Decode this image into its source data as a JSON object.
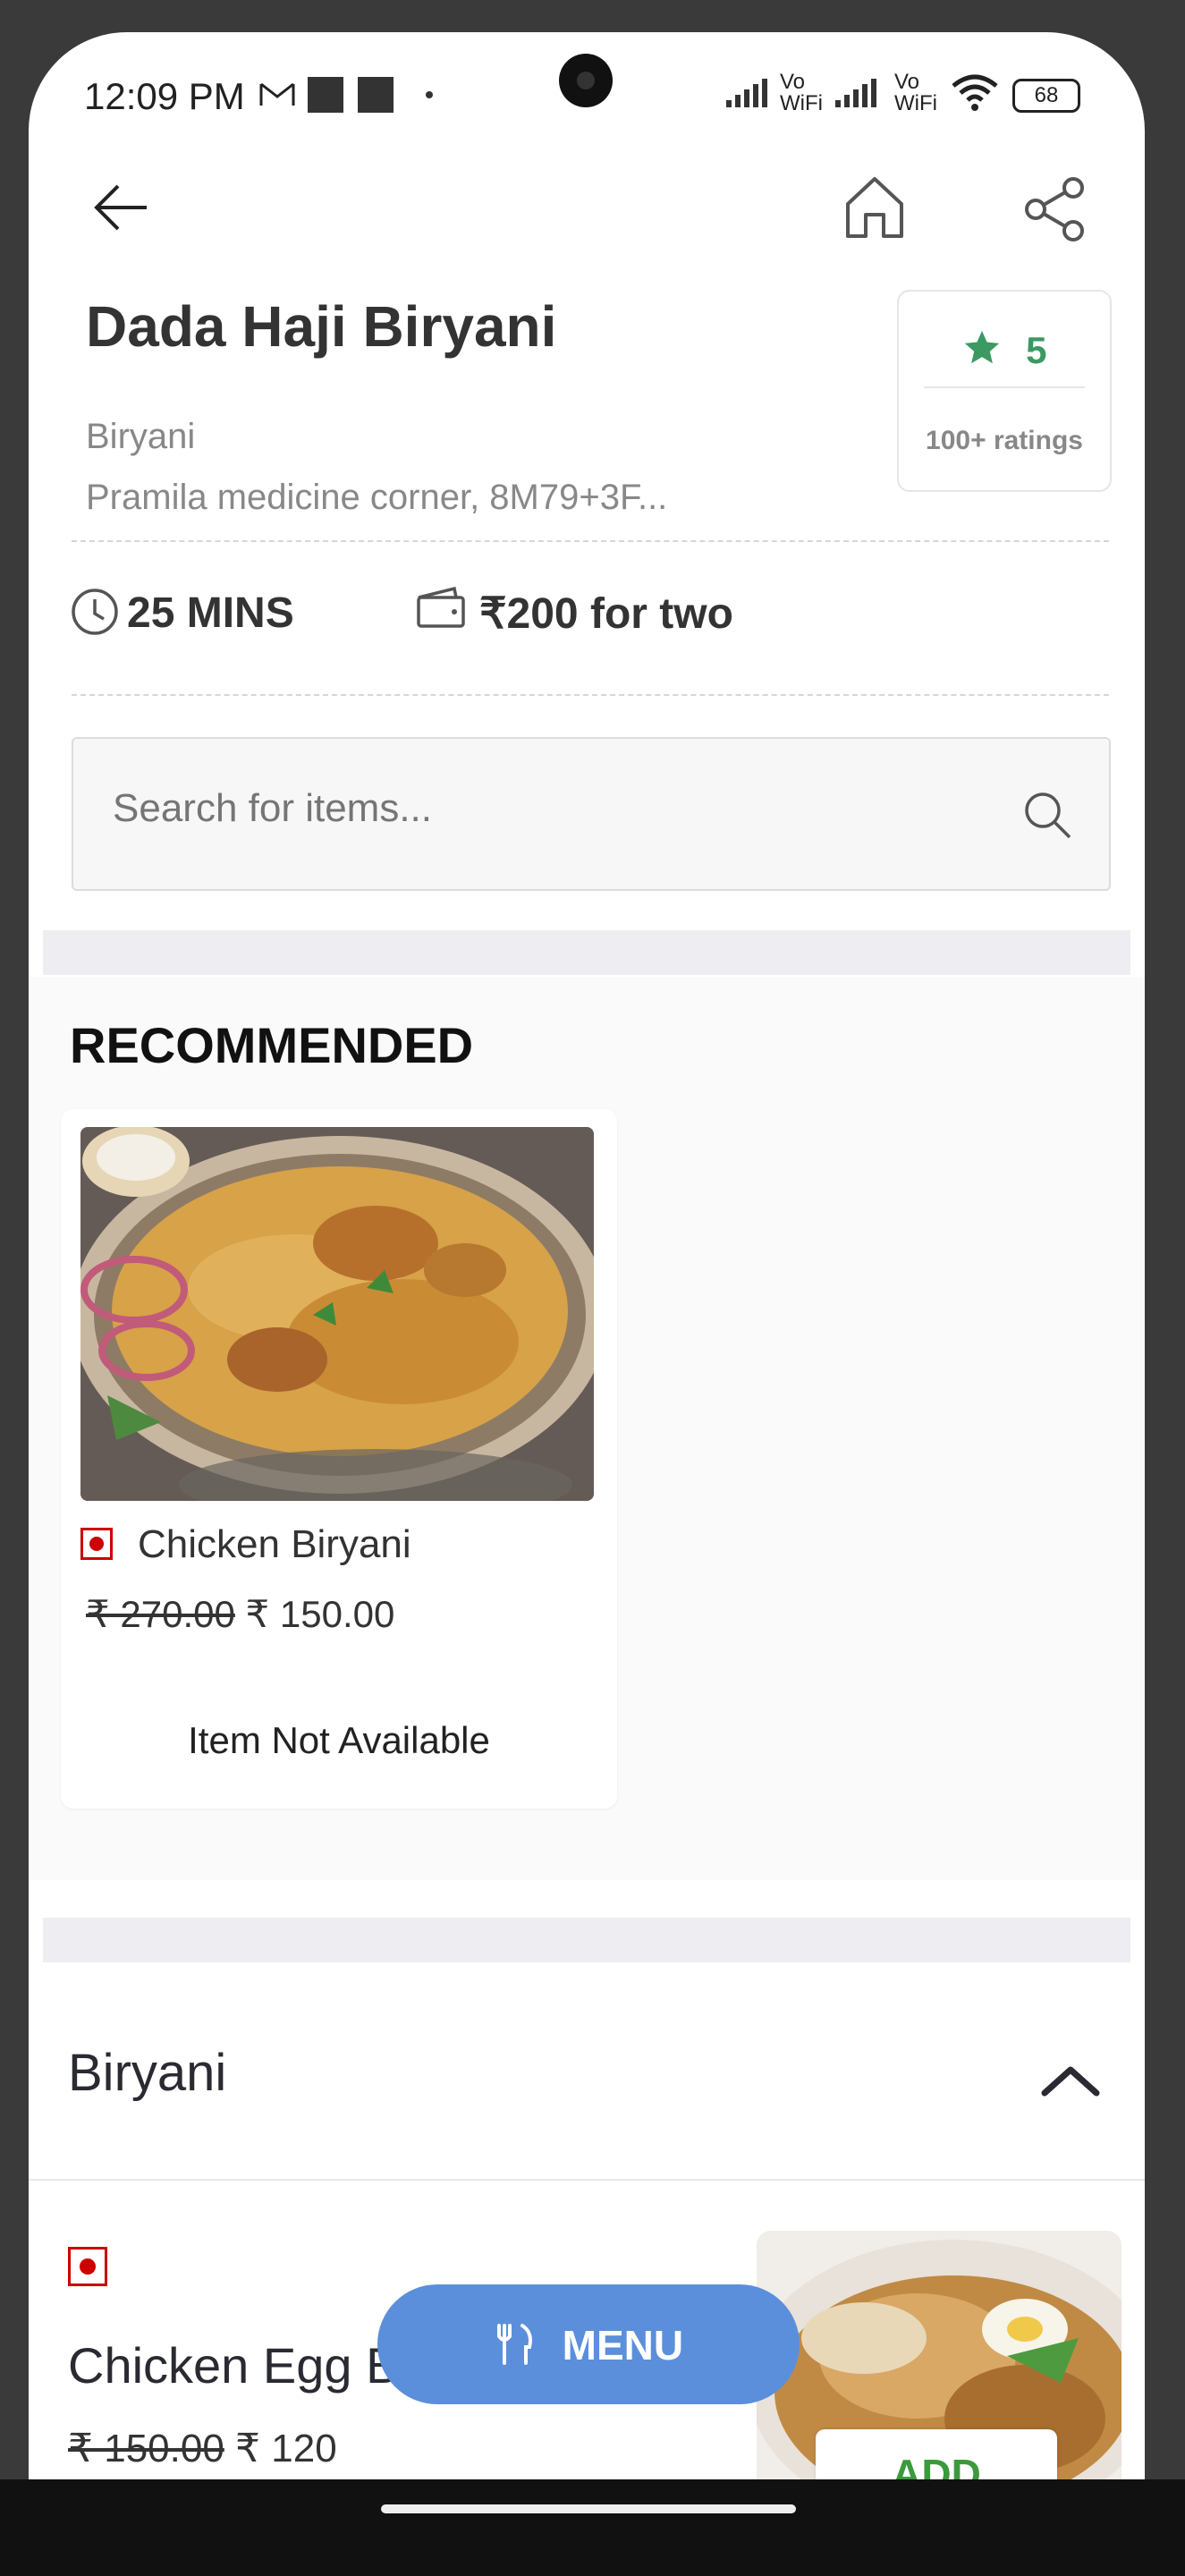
{
  "status_bar": {
    "time": "12:09 PM",
    "network": "Vo WiFi  Vo WiFi",
    "battery": "68"
  },
  "header": {
    "title": "Dada Haji Biryani",
    "cuisine": "Biryani",
    "address": "Pramila medicine corner, 8M79+3F..."
  },
  "rating": {
    "value": "5",
    "count": "100+ ratings"
  },
  "info": {
    "time": "25 MINS",
    "cost": "₹200 for two"
  },
  "search": {
    "placeholder": "Search for items..."
  },
  "recommended": {
    "title": "RECOMMENDED",
    "items": [
      {
        "name": "Chicken Biryani",
        "original_price": "₹ 270.00",
        "price": "₹ 150.00",
        "status": "Item Not Available"
      }
    ]
  },
  "section": {
    "title": "Biryani",
    "items": [
      {
        "name": "Chicken Egg B",
        "original_price": "₹ 150.00",
        "price": "₹ 120",
        "add_label": "ADD"
      }
    ]
  },
  "floating": {
    "menu_label": "MENU"
  },
  "colors": {
    "accent": "#5b8fdb",
    "rating_green": "#3a9a62",
    "nonveg_red": "#cc0000",
    "add_green": "#3b9a3b"
  }
}
